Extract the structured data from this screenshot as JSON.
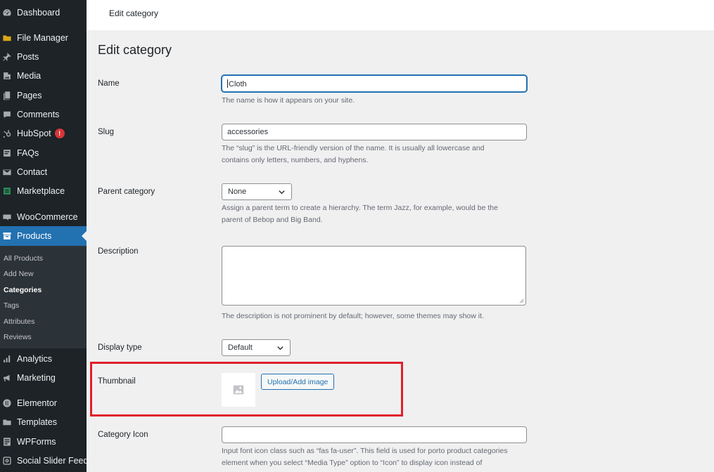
{
  "sidebar": {
    "items": [
      {
        "label": "Dashboard",
        "icon": "dashboard-icon"
      },
      {
        "label": "File Manager",
        "icon": "folder-icon"
      },
      {
        "label": "Posts",
        "icon": "pin-icon"
      },
      {
        "label": "Media",
        "icon": "media-icon"
      },
      {
        "label": "Pages",
        "icon": "pages-icon"
      },
      {
        "label": "Comments",
        "icon": "comment-icon"
      },
      {
        "label": "HubSpot",
        "icon": "hubspot-icon",
        "badge": "!"
      },
      {
        "label": "FAQs",
        "icon": "faq-icon"
      },
      {
        "label": "Contact",
        "icon": "mail-icon"
      },
      {
        "label": "Marketplace",
        "icon": "marketplace-icon"
      },
      {
        "label": "WooCommerce",
        "icon": "woo-icon"
      },
      {
        "label": "Products",
        "icon": "archive-icon"
      },
      {
        "label": "Analytics",
        "icon": "chart-icon"
      },
      {
        "label": "Marketing",
        "icon": "megaphone-icon"
      },
      {
        "label": "Elementor",
        "icon": "elementor-icon"
      },
      {
        "label": "Templates",
        "icon": "folder-icon"
      },
      {
        "label": "WPForms",
        "icon": "forms-icon"
      },
      {
        "label": "Social Slider Feeds",
        "icon": "instagram-icon"
      }
    ],
    "submenu": [
      "All Products",
      "Add New",
      "Categories",
      "Tags",
      "Attributes",
      "Reviews"
    ],
    "active_color": "#2271b1"
  },
  "topbar": {
    "title": "Edit category"
  },
  "page": {
    "heading": "Edit category",
    "name": {
      "label": "Name",
      "value": "Cloth",
      "help": "The name is how it appears on your site."
    },
    "slug": {
      "label": "Slug",
      "value": "accessories",
      "help_line1": "The “slug” is the URL-friendly version of the name. It is usually all lowercase and",
      "help_line2": "contains only letters, numbers, and hyphens."
    },
    "parent": {
      "label": "Parent category",
      "value": "None",
      "help_line1": "Assign a parent term to create a hierarchy. The term Jazz, for example, would be the",
      "help_line2": "parent of Bebop and Big Band."
    },
    "description": {
      "label": "Description",
      "value": "",
      "help": "The description is not prominent by default; however, some themes may show it."
    },
    "display_type": {
      "label": "Display type",
      "value": "Default"
    },
    "thumbnail": {
      "label": "Thumbnail",
      "button": "Upload/Add image",
      "highlight_color": "#e0202b"
    },
    "category_icon": {
      "label": "Category Icon",
      "value": "",
      "help_line1": "Input font icon class such as “fas fa-user”. This field is used for porto product categories",
      "help_line2": "element when you select “Media Type” option to “Icon” to display icon instead of"
    }
  }
}
